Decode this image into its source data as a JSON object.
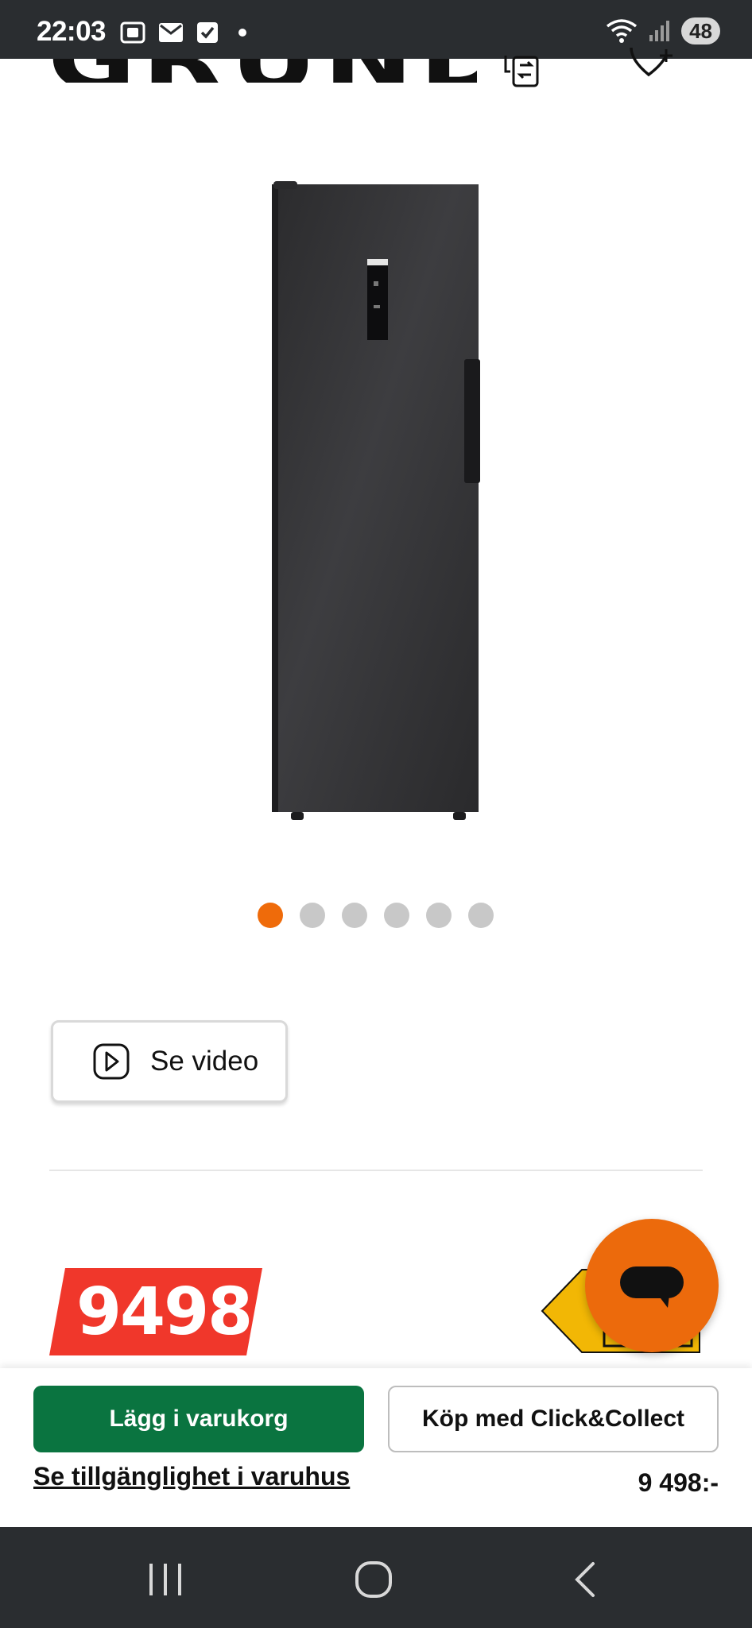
{
  "status_bar": {
    "time": "22:03",
    "battery": "48",
    "icons_left": [
      "screenshot-icon",
      "mail-icon",
      "check-icon",
      "dot-icon"
    ],
    "icons_right": [
      "wifi-icon",
      "signal-icon",
      "battery-icon"
    ]
  },
  "header": {
    "brand": "GRUNDIG",
    "icons": [
      "compare-icon",
      "wishlist-add-icon"
    ]
  },
  "carousel": {
    "total": 6,
    "active_index": 0,
    "colors": {
      "active": "#ef6b0a",
      "inactive": "#c8c8c8"
    }
  },
  "video_button": {
    "label": "Se video",
    "icon": "play-icon"
  },
  "price": {
    "amount": "9498",
    "color": "#f0372b"
  },
  "energy_label": {
    "color": "#f2b705"
  },
  "chat_button": {
    "icon": "chat-bubble-icon",
    "color": "#ec6a0c"
  },
  "action_panel": {
    "add_to_cart": "Lägg i varukorg",
    "click_collect": "Köp med Click&Collect",
    "store_availability": "Se tillgänglighet i varuhus",
    "price": "9 498:-",
    "primary_color": "#0a7440"
  },
  "nav_bar": {
    "icons": [
      "recents-icon",
      "home-icon",
      "back-icon"
    ]
  }
}
